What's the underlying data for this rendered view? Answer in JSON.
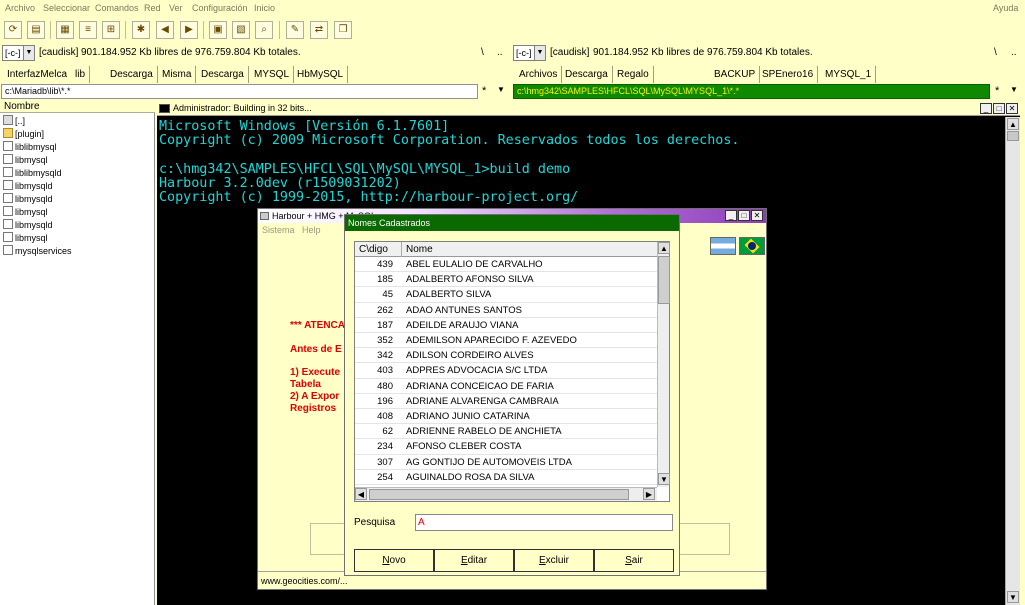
{
  "menubar": {
    "items": [
      "Archivo",
      "Seleccionar",
      "Comandos",
      "Red",
      "Ver",
      "Configuración",
      "Inicio"
    ],
    "help": "Ayuda"
  },
  "left": {
    "drive": "[-c-]",
    "volume": "[caudisk]",
    "free": "901.184.952 Kb libres de 976.759.804 Kb totales.",
    "root_btn": "\\",
    "up_btn": "..",
    "tabs": [
      "InterfazMelca",
      "lib",
      "Descarga",
      "Misma",
      "Descarga",
      "MYSQL",
      "HbMySQL"
    ],
    "path": "c:\\Mariadb\\lib\\*.*",
    "filter": "*",
    "header": "Nombre",
    "files": [
      {
        "name": "[..]",
        "icon": "up-icon"
      },
      {
        "name": "[plugin]",
        "icon": "folder-icon"
      },
      {
        "name": "liblibmysql",
        "icon": "file-icon"
      },
      {
        "name": "libmysql",
        "icon": "file-icon"
      },
      {
        "name": "liblibmysqld",
        "icon": "file-icon"
      },
      {
        "name": "libmysqld",
        "icon": "file-icon"
      },
      {
        "name": "libmysqld",
        "icon": "file-icon"
      },
      {
        "name": "libmysql",
        "icon": "file-icon"
      },
      {
        "name": "libmysqld",
        "icon": "file-icon"
      },
      {
        "name": "libmysql",
        "icon": "file-icon"
      },
      {
        "name": "mysqlservices",
        "icon": "file-icon"
      }
    ]
  },
  "right": {
    "drive": "[-c-]",
    "volume": "[caudisk]",
    "free": "901.184.952 Kb libres de 976.759.804 Kb totales.",
    "root_btn": "\\",
    "up_btn": "..",
    "tabs": [
      "Archivos",
      "Descarga",
      "Regalo",
      "BACKUP",
      "SPEnero16",
      "MYSQL_1"
    ],
    "path": "c:\\hmg342\\SAMPLES\\HFCL\\SQL\\MySQL\\MYSQL_1\\*.*",
    "filter": "*"
  },
  "console": {
    "title": "Administrador:  Building in 32 bits...",
    "lines": [
      "Microsoft Windows [Versión 6.1.7601]",
      "Copyright (c) 2009 Microsoft Corporation. Reservados todos los derechos.",
      "",
      "c:\\hmg342\\SAMPLES\\HFCL\\SQL\\MySQL\\MYSQL_1>build demo",
      "Harbour 3.2.0dev (r1509031202)",
      "Copyright (c) 1999-2015, http://harbour-project.org/"
    ]
  },
  "harbour": {
    "title": "Harbour + HMG + MySQL",
    "menu": [
      "Sistema",
      "Help"
    ],
    "warn1": "*** ATENCA",
    "warn2": "Antes de E",
    "warn3": "1) Execute",
    "warn4": "Tabela",
    "warn5": "2) A Expor",
    "warn6": "Registros",
    "status": "www.geocities.com/..."
  },
  "dialog": {
    "title": "Nomes Cadastrados",
    "col_code": "C\\digo",
    "col_name": "Nome",
    "rows": [
      {
        "code": "439",
        "name": "ABEL EULALIO DE CARVALHO"
      },
      {
        "code": "185",
        "name": "ADALBERTO AFONSO SILVA"
      },
      {
        "code": "45",
        "name": "ADALBERTO SILVA"
      },
      {
        "code": "262",
        "name": "ADAO ANTUNES SANTOS"
      },
      {
        "code": "187",
        "name": "ADEILDE ARAUJO VIANA"
      },
      {
        "code": "352",
        "name": "ADEMILSON APARECIDO F. AZEVEDO"
      },
      {
        "code": "342",
        "name": "ADILSON CORDEIRO ALVES"
      },
      {
        "code": "403",
        "name": "ADPRES ADVOCACIA S/C LTDA"
      },
      {
        "code": "480",
        "name": "ADRIANA CONCEICAO DE FARIA"
      },
      {
        "code": "196",
        "name": "ADRIANE ALVARENGA CAMBRAIA"
      },
      {
        "code": "408",
        "name": "ADRIANO JUNIO CATARINA"
      },
      {
        "code": "62",
        "name": "ADRIENNE RABELO DE ANCHIETA"
      },
      {
        "code": "234",
        "name": "AFONSO CLEBER COSTA"
      },
      {
        "code": "307",
        "name": "AG GONTIJO DE AUTOMOVEIS LTDA"
      },
      {
        "code": "254",
        "name": "AGUINALDO ROSA DA SILVA"
      }
    ],
    "search_label": "Pesquisa",
    "search_value": "A",
    "buttons": [
      "Novo",
      "Editar",
      "Excluir",
      "Sair"
    ]
  }
}
